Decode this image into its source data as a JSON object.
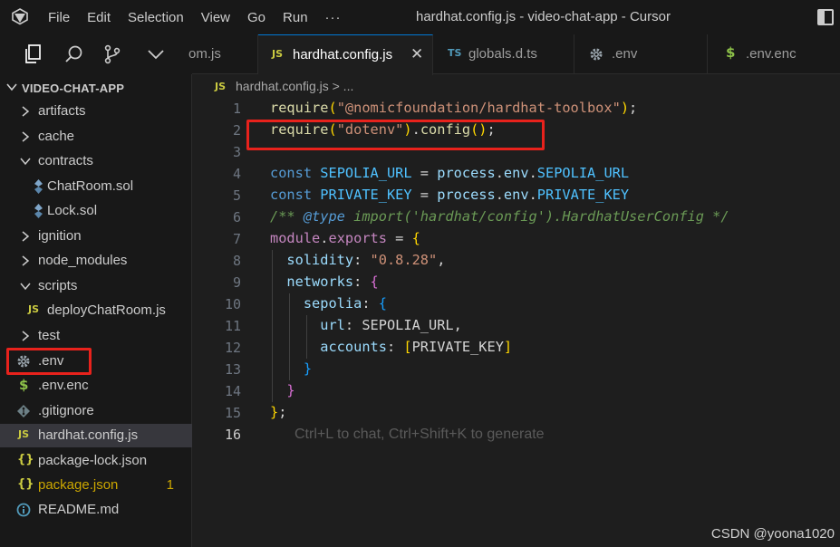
{
  "window": {
    "title": "hardhat.config.js - video-chat-app - Cursor",
    "menu": [
      "File",
      "Edit",
      "Selection",
      "View",
      "Go",
      "Run",
      "···"
    ]
  },
  "sidebar": {
    "project": "VIDEO-CHAT-APP",
    "items": [
      {
        "label": "artifacts",
        "kind": "folder",
        "expanded": false
      },
      {
        "label": "cache",
        "kind": "folder",
        "expanded": false
      },
      {
        "label": "contracts",
        "kind": "folder",
        "expanded": true
      },
      {
        "label": "ChatRoom.sol",
        "kind": "file",
        "icon": "solidity-icon"
      },
      {
        "label": "Lock.sol",
        "kind": "file",
        "icon": "solidity-icon"
      },
      {
        "label": "ignition",
        "kind": "folder",
        "expanded": false
      },
      {
        "label": "node_modules",
        "kind": "folder",
        "expanded": false
      },
      {
        "label": "scripts",
        "kind": "folder",
        "expanded": true
      },
      {
        "label": "deployChatRoom.js",
        "kind": "file",
        "icon": "JS"
      },
      {
        "label": "test",
        "kind": "folder",
        "expanded": false
      },
      {
        "label": ".env",
        "kind": "file",
        "icon": "gear-icon"
      },
      {
        "label": ".env.enc",
        "kind": "file",
        "icon": "$"
      },
      {
        "label": ".gitignore",
        "kind": "file",
        "icon": "git-icon"
      },
      {
        "label": "hardhat.config.js",
        "kind": "file",
        "icon": "JS",
        "selected": true
      },
      {
        "label": "package-lock.json",
        "kind": "file",
        "icon": "{}"
      },
      {
        "label": "package.json",
        "kind": "file",
        "icon": "{}",
        "badge": "1"
      },
      {
        "label": "README.md",
        "kind": "file",
        "icon": "info-icon"
      }
    ]
  },
  "tabs": [
    {
      "label": "om.js",
      "icon": ""
    },
    {
      "label": "hardhat.config.js",
      "icon": "JS",
      "active": true,
      "close": "✕"
    },
    {
      "label": "globals.d.ts",
      "icon": "TS"
    },
    {
      "label": ".env",
      "icon": "gear-icon"
    },
    {
      "label": ".env.enc",
      "icon": "$"
    }
  ],
  "breadcrumb": {
    "icon": "JS",
    "text": "hardhat.config.js > ..."
  },
  "editor": {
    "line_numbers": [
      "1",
      "2",
      "3",
      "4",
      "5",
      "6",
      "7",
      "8",
      "9",
      "10",
      "11",
      "12",
      "13",
      "14",
      "15",
      "16"
    ],
    "current_line": "16",
    "hint": "Ctrl+L to chat, Ctrl+Shift+K to generate",
    "lines": [
      "require(\"@nomicfoundation/hardhat-toolbox\");",
      "require(\"dotenv\").config();",
      "",
      "const SEPOLIA_URL = process.env.SEPOLIA_URL",
      "const PRIVATE_KEY = process.env.PRIVATE_KEY",
      "/** @type import('hardhat/config').HardhatUserConfig */",
      "module.exports = {",
      "  solidity: \"0.8.28\",",
      "  networks: {",
      "    sepolia: {",
      "      url: SEPOLIA_URL,",
      "      accounts: [PRIVATE_KEY]",
      "    }",
      "  }",
      "};",
      ""
    ]
  },
  "watermark": "CSDN @yoona1020",
  "colors": {
    "annotation": "#e8221c",
    "accent": "#0078d4"
  }
}
